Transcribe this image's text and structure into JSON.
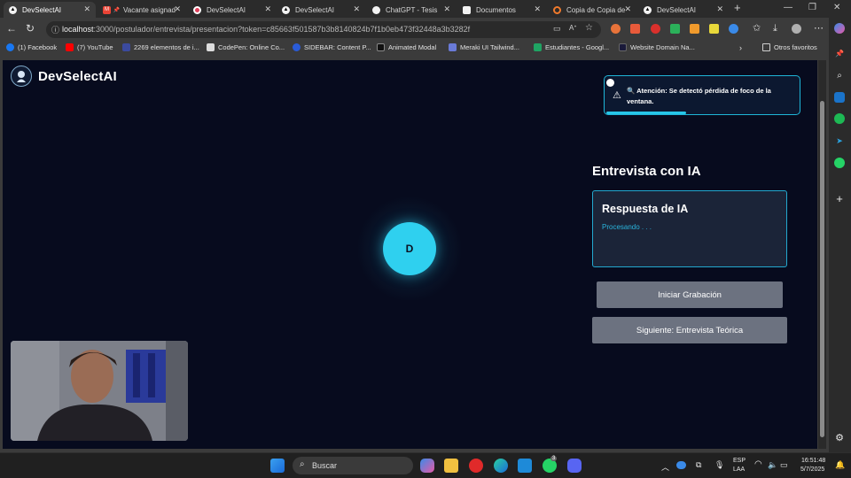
{
  "tabs": [
    {
      "label": "DevSelectAI",
      "active": true
    },
    {
      "label": "Vacante asignad"
    },
    {
      "label": "DevSelectAI"
    },
    {
      "label": "DevSelectAI"
    },
    {
      "label": "ChatGPT - Tesis"
    },
    {
      "label": "Documentos"
    },
    {
      "label": "Copia de Copia de"
    },
    {
      "label": "DevSelectAI"
    }
  ],
  "browser": {
    "url_host": "localhost",
    "url_rest": ":3000/postulador/entrevista/presentacion?token=c85663f501587b3b8140824b7f1b0eb473f32448a3b3282f"
  },
  "bookmarks": [
    {
      "label": "(1) Facebook",
      "color": "#1877f2"
    },
    {
      "label": "(7) YouTube",
      "color": "#ff0000"
    },
    {
      "label": "2269 elementos de i...",
      "color": "#3b4a9e"
    },
    {
      "label": "CodePen: Online Co...",
      "color": "#dddddd"
    },
    {
      "label": "SIDEBAR: Content P...",
      "color": "#2a5bd7"
    },
    {
      "label": "Animated Modal",
      "color": "#111111"
    },
    {
      "label": "Meraki UI Tailwind...",
      "color": "#6a7bd8"
    },
    {
      "label": "Estudiantes - Googl...",
      "color": "#1fa463"
    },
    {
      "label": "Website Domain Na...",
      "color": "#1a1a3a"
    }
  ],
  "bookmarks_other": "Otros favoritos",
  "app": {
    "title": "DevSelectAI",
    "alert_text": "🔍 Atención: Se detectó pérdida de foco de la ventana.",
    "alert_icon": "warning-icon",
    "avatar_letter": "D",
    "interview_title": "Entrevista con IA",
    "response_title": "Respuesta de IA",
    "response_status": "Procesando . . .",
    "record_button": "Iniciar Grabación",
    "next_button": "Siguiente: Entrevista Teórica",
    "accent_color": "#2fd0ef",
    "button_color": "#6c7280"
  },
  "taskbar": {
    "search_placeholder": "Buscar",
    "lang_top": "ESP",
    "lang_bottom": "LAA",
    "time": "16:51:48",
    "date": "5/7/2025",
    "badge_count": "3"
  }
}
